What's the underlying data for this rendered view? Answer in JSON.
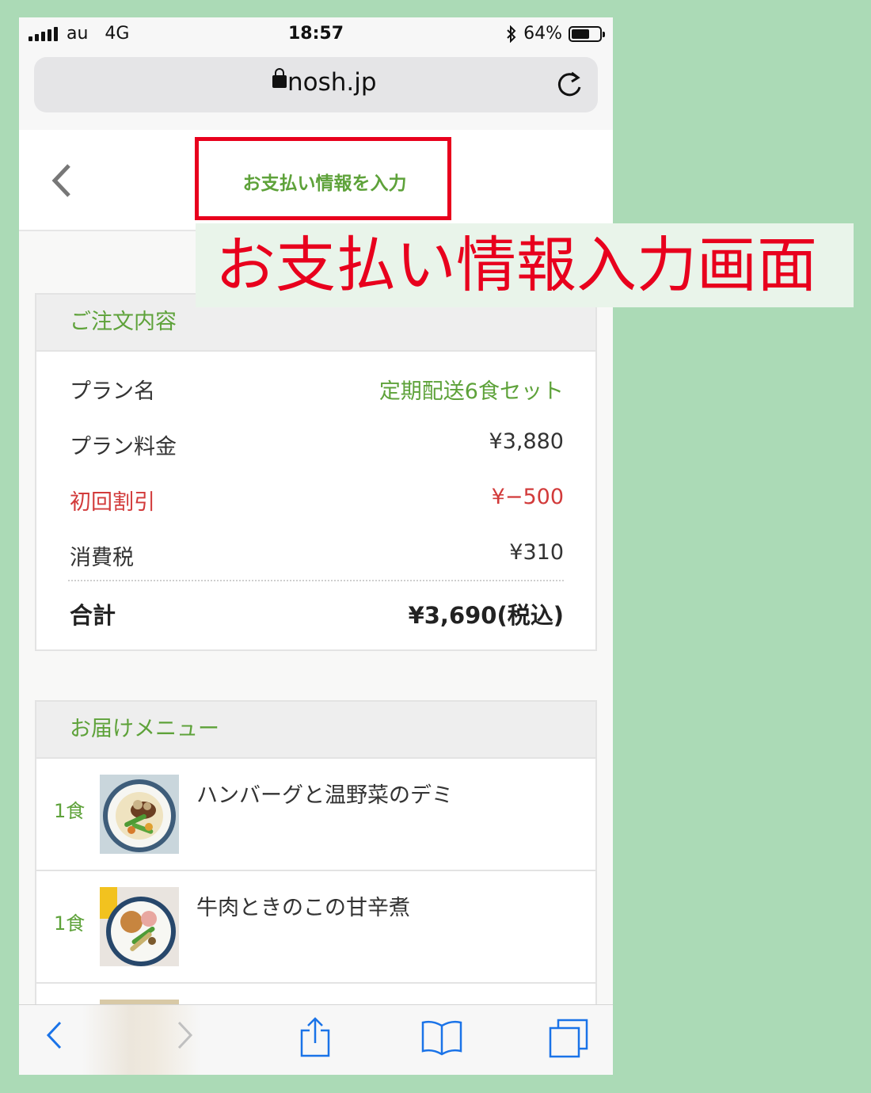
{
  "status_bar": {
    "carrier": "au",
    "network": "4G",
    "time": "18:57",
    "battery": "64%",
    "battery_level": 0.64
  },
  "browser": {
    "url": "nosh.jp"
  },
  "header": {
    "title": "お支払い情報を入力"
  },
  "annotation": {
    "label": "お支払い情報入力画面"
  },
  "order": {
    "heading": "ご注文内容",
    "rows": [
      {
        "label": "プラン名",
        "value": "定期配送6食セット"
      },
      {
        "label": "プラン料金",
        "value": "¥3,880"
      },
      {
        "label": "初回割引",
        "value": "¥−500"
      },
      {
        "label": "消費税",
        "value": "¥310"
      }
    ],
    "total_label": "合計",
    "total_value": "¥3,690(税込)"
  },
  "delivery": {
    "heading": "お届けメニュー",
    "items": [
      {
        "qty": "1食",
        "name": "ハンバーグと温野菜のデミ"
      },
      {
        "qty": "1食",
        "name": "牛肉ときのこの甘辛煮"
      }
    ]
  },
  "colors": {
    "accent": "#5ea23a",
    "discount": "#d23a3a",
    "annotation": "#e8001d",
    "background": "#abdab6"
  }
}
